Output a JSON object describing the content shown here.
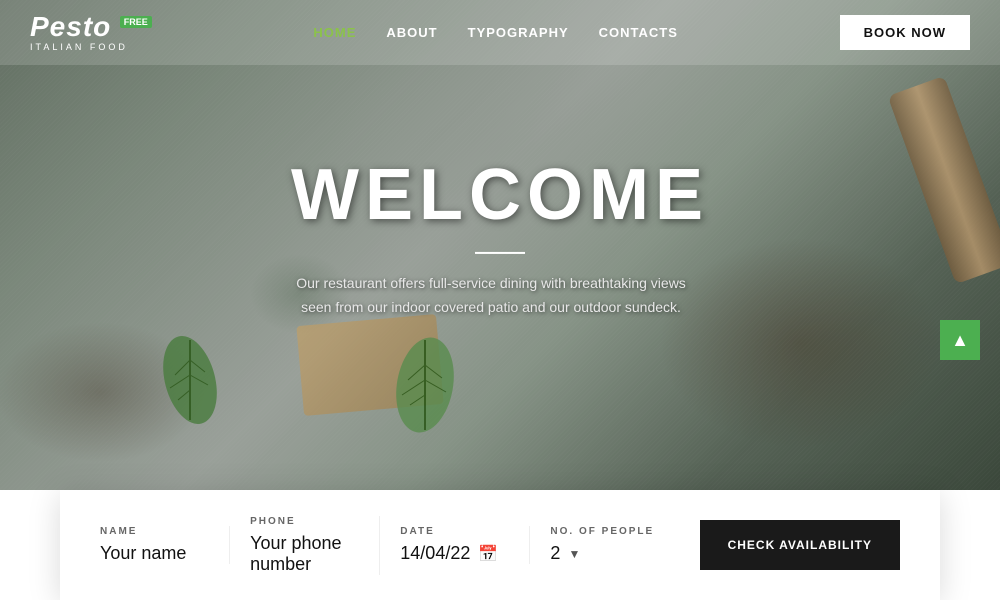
{
  "logo": {
    "title": "Pesto",
    "badge": "FREE",
    "subtitle": "ITALIAN FOOD"
  },
  "nav": {
    "links": [
      {
        "label": "HOME",
        "active": true
      },
      {
        "label": "ABOUT",
        "active": false
      },
      {
        "label": "TYPOGRAPHY",
        "active": false
      },
      {
        "label": "CONTACTS",
        "active": false
      }
    ],
    "book_now": "BOOK NOW"
  },
  "hero": {
    "title": "WELCOME",
    "subtitle": "Our restaurant offers full-service dining with breathtaking views seen from our indoor covered patio and our outdoor sundeck."
  },
  "booking": {
    "name_label": "NAME",
    "name_value": "Your name",
    "phone_label": "PHONE",
    "phone_value": "Your phone number",
    "date_label": "DATE",
    "date_value": "14/04/22",
    "people_label": "NO. OF PEOPLE",
    "people_value": "2",
    "check_btn": "CHECK AVAILABILITY"
  },
  "scroll_up_icon": "▲"
}
